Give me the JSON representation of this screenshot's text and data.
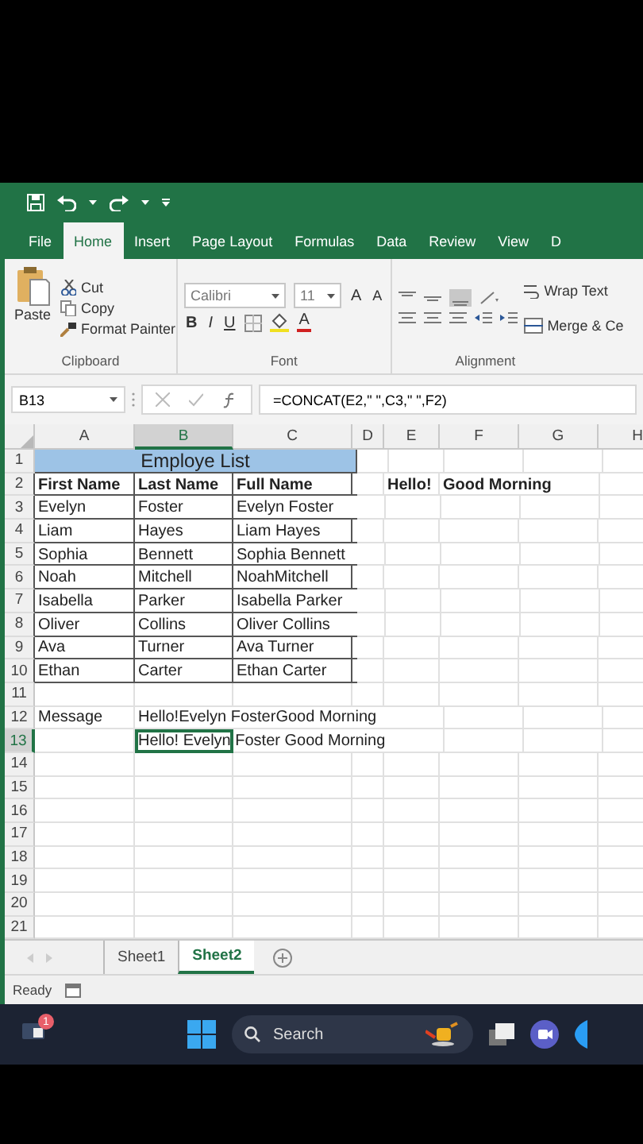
{
  "ribbon_tabs": [
    {
      "label": "File",
      "selected": false
    },
    {
      "label": "Home",
      "selected": true
    },
    {
      "label": "Insert",
      "selected": false
    },
    {
      "label": "Page Layout",
      "selected": false
    },
    {
      "label": "Formulas",
      "selected": false
    },
    {
      "label": "Data",
      "selected": false
    },
    {
      "label": "Review",
      "selected": false
    },
    {
      "label": "View",
      "selected": false
    },
    {
      "label": "D",
      "selected": false
    }
  ],
  "clipboard": {
    "paste": "Paste",
    "items": [
      "Cut",
      "Copy",
      "Format Painter"
    ],
    "label": "Clipboard"
  },
  "font": {
    "name": "Calibri",
    "size": "11",
    "grow": "A",
    "shrink": "A",
    "bold": "B",
    "italic": "I",
    "underline": "U",
    "font_color_button": "A",
    "label": "Font"
  },
  "alignment": {
    "wrap": "Wrap Text",
    "merge": "Merge & Ce",
    "label": "Alignment"
  },
  "formula_bar": {
    "name_box": "B13",
    "formula": "=CONCAT(E2,\" \",C3,\" \",F2)"
  },
  "columns": [
    {
      "label": "A",
      "selected": false
    },
    {
      "label": "B",
      "selected": true
    },
    {
      "label": "C",
      "selected": false
    },
    {
      "label": "D",
      "selected": false
    },
    {
      "label": "E",
      "selected": false
    },
    {
      "label": "F",
      "selected": false
    },
    {
      "label": "G",
      "selected": false
    },
    {
      "label": "H",
      "selected": false
    }
  ],
  "rows": [
    {
      "number": "1",
      "selected": false,
      "kind": "title",
      "title": "Employe List"
    },
    {
      "number": "2",
      "selected": false,
      "kind": "header",
      "cells": {
        "A": "First Name",
        "B": "Last Name",
        "C": "Full Name",
        "E": "Hello!",
        "F": "Good Morning"
      }
    },
    {
      "number": "3",
      "selected": false,
      "kind": "table",
      "cells": {
        "A": "Evelyn",
        "B": "Foster",
        "C": "Evelyn Foster"
      }
    },
    {
      "number": "4",
      "selected": false,
      "kind": "table",
      "cells": {
        "A": "Liam",
        "B": "Hayes",
        "C": "Liam Hayes"
      }
    },
    {
      "number": "5",
      "selected": false,
      "kind": "table",
      "cells": {
        "A": "Sophia",
        "B": "Bennett",
        "C": "Sophia Bennett"
      }
    },
    {
      "number": "6",
      "selected": false,
      "kind": "table",
      "cells": {
        "A": "Noah",
        "B": "Mitchell",
        "C": "NoahMitchell"
      }
    },
    {
      "number": "7",
      "selected": false,
      "kind": "table",
      "cells": {
        "A": "Isabella",
        "B": "Parker",
        "C": "Isabella Parker"
      }
    },
    {
      "number": "8",
      "selected": false,
      "kind": "table",
      "cells": {
        "A": "Oliver",
        "B": "Collins",
        "C": "Oliver Collins"
      }
    },
    {
      "number": "9",
      "selected": false,
      "kind": "table",
      "cells": {
        "A": "Ava",
        "B": "Turner",
        "C": "Ava Turner"
      }
    },
    {
      "number": "10",
      "selected": false,
      "kind": "table",
      "cells": {
        "A": "Ethan",
        "B": "Carter",
        "C": "Ethan Carter"
      }
    },
    {
      "number": "11",
      "selected": false,
      "kind": "plain"
    },
    {
      "number": "12",
      "selected": false,
      "kind": "plain",
      "cells": {
        "A": "Message",
        "B": "Hello!Evelyn FosterGood Morning"
      }
    },
    {
      "number": "13",
      "selected": true,
      "kind": "plain",
      "cells": {
        "B": "Hello! Evelyn Foster Good Morning"
      }
    },
    {
      "number": "14",
      "selected": false,
      "kind": "plain"
    },
    {
      "number": "15",
      "selected": false,
      "kind": "plain"
    },
    {
      "number": "16",
      "selected": false,
      "kind": "plain"
    },
    {
      "number": "17",
      "selected": false,
      "kind": "plain"
    },
    {
      "number": "18",
      "selected": false,
      "kind": "plain"
    },
    {
      "number": "19",
      "selected": false,
      "kind": "plain"
    },
    {
      "number": "20",
      "selected": false,
      "kind": "plain"
    },
    {
      "number": "21",
      "selected": false,
      "kind": "plain"
    }
  ],
  "sheet_tabs": [
    {
      "label": "Sheet1",
      "selected": false
    },
    {
      "label": "Sheet2",
      "selected": true
    }
  ],
  "status_bar": {
    "text": "Ready"
  },
  "taskbar": {
    "badge": "1",
    "search_placeholder": "Search"
  }
}
